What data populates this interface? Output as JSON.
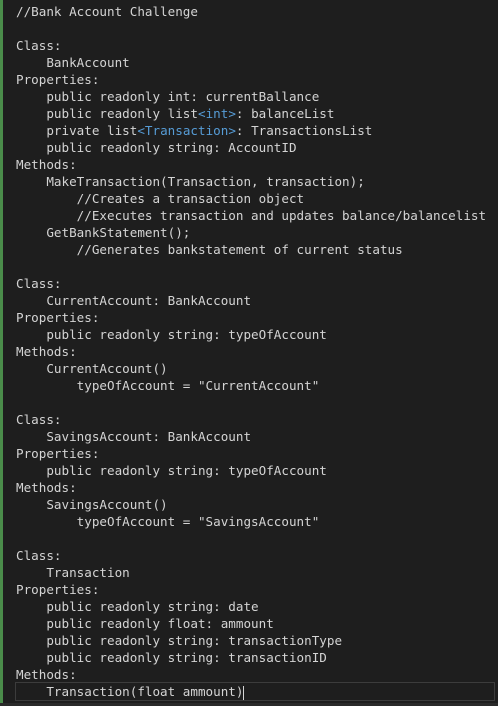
{
  "editor": {
    "lines": [
      "//Bank Account Challenge",
      "",
      "Class:",
      "    BankAccount",
      "Properties:",
      "    public readonly int: currentBallance",
      [
        "    public readonly list",
        {
          "g": "<int>"
        },
        ": balanceList"
      ],
      [
        "    private list",
        {
          "g": "<Transaction>"
        },
        ": TransactionsList"
      ],
      "    public readonly string: AccountID",
      "Methods:",
      "    MakeTransaction(Transaction, transaction);",
      "        //Creates a transaction object",
      "        //Executes transaction and updates balance/balancelist",
      "    GetBankStatement();",
      "        //Generates bankstatement of current status",
      "",
      "Class:",
      "    CurrentAccount: BankAccount",
      "Properties:",
      "    public readonly string: typeOfAccount",
      "Methods:",
      "    CurrentAccount()",
      "        typeOfAccount = \"CurrentAccount\"",
      "",
      "Class:",
      "    SavingsAccount: BankAccount",
      "Properties:",
      "    public readonly string: typeOfAccount",
      "Methods:",
      "    SavingsAccount()",
      "        typeOfAccount = \"SavingsAccount\"",
      "",
      "Class:",
      "    Transaction",
      "Properties:",
      "    public readonly string: date",
      "    public readonly float: ammount",
      "    public readonly string: transactionType",
      "    public readonly string: transactionID",
      "Methods:",
      "    Transaction(float ammount)"
    ],
    "current_line": 40,
    "colors": {
      "background": "#1e1e1e",
      "text": "#d4d4d4",
      "generic": "#569cd6",
      "gutter_indicator": "#4a8c4a"
    }
  }
}
